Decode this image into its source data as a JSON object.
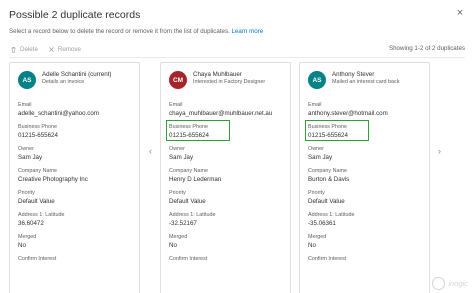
{
  "dialog": {
    "title": "Possible 2 duplicate records",
    "subtitle": "Select a record below to delete the record or remove it from the list of duplicates.",
    "learn_more": "Learn more",
    "close_glyph": "×"
  },
  "toolbar": {
    "delete_label": "Delete",
    "remove_label": "Remove",
    "showing": "Showing 1-2 of 2 duplicates"
  },
  "nav": {
    "prev_glyph": "‹",
    "next_glyph": "›"
  },
  "cards": [
    {
      "initials": "AS",
      "avatar_color": "#038387",
      "name": "Adelle Schantini (current)",
      "subtitle": "Details an invoice",
      "fields": [
        {
          "label": "Email",
          "value": "adelle_schantini@yahoo.com"
        },
        {
          "label": "Business Phone",
          "value": "01215-655624"
        },
        {
          "label": "Owner",
          "value": "Sam Jay"
        },
        {
          "label": "Company Name",
          "value": "Creative Photography Inc"
        },
        {
          "label": "Priority",
          "value": "Default Value"
        },
        {
          "label": "Address 1: Latitude",
          "value": "36.60472"
        },
        {
          "label": "Merged",
          "value": "No"
        },
        {
          "label": "Confirm Interest",
          "value": ""
        }
      ]
    },
    {
      "initials": "CM",
      "avatar_color": "#a4262c",
      "name": "Chaya Muhlbauer",
      "subtitle": "Interested in Factory Designer",
      "fields": [
        {
          "label": "Email",
          "value": "chaya_muhlbauer@muhlbauer.net.au"
        },
        {
          "label": "Business Phone",
          "value": "01215-655624"
        },
        {
          "label": "Owner",
          "value": "Sam Jay"
        },
        {
          "label": "Company Name",
          "value": "Henry D Lederman"
        },
        {
          "label": "Priority",
          "value": "Default Value"
        },
        {
          "label": "Address 1: Latitude",
          "value": "-32.52167"
        },
        {
          "label": "Merged",
          "value": "No"
        },
        {
          "label": "Confirm Interest",
          "value": ""
        }
      ]
    },
    {
      "initials": "AS",
      "avatar_color": "#038387",
      "name": "Anthony Stever",
      "subtitle": "Mailed an interest card back",
      "fields": [
        {
          "label": "Email",
          "value": "anthony.stever@hotmail.com"
        },
        {
          "label": "Business Phone",
          "value": "01215-655624"
        },
        {
          "label": "Owner",
          "value": "Sam Jay"
        },
        {
          "label": "Company Name",
          "value": "Burton & Davis"
        },
        {
          "label": "Priority",
          "value": "Default Value"
        },
        {
          "label": "Address 1: Latitude",
          "value": "-35.06361"
        },
        {
          "label": "Merged",
          "value": "No"
        },
        {
          "label": "Confirm Interest",
          "value": ""
        }
      ]
    }
  ],
  "watermark": {
    "text": "inogic"
  }
}
